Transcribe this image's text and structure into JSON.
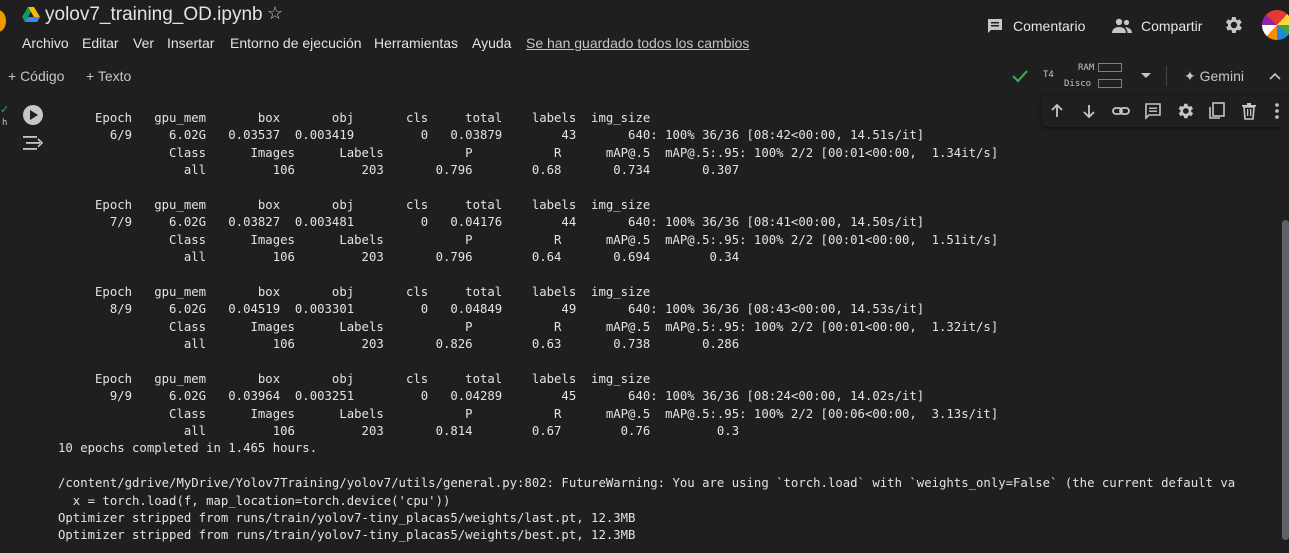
{
  "app": {
    "title": "yolov7_training_OD.ipynb"
  },
  "menu": {
    "items": [
      "Archivo",
      "Editar",
      "Ver",
      "Insertar",
      "Entorno de ejecución",
      "Herramientas",
      "Ayuda"
    ],
    "saved_status": "Se han guardado todos los cambios"
  },
  "header": {
    "comment_label": "Comentario",
    "share_label": "Compartir"
  },
  "toolbar": {
    "code_label": "+ Código",
    "text_label": "+ Texto",
    "runtime_type": "T4",
    "ram_label": "RAM",
    "disk_label": "Disco",
    "gemini_label": "Gemini"
  },
  "cell": {
    "status_check": "✓",
    "status_short": "h"
  },
  "output": {
    "lines": [
      "     Epoch   gpu_mem       box       obj       cls     total    labels  img_size",
      "       6/9     6.02G   0.03537  0.003419         0   0.03879        43       640: 100% 36/36 [08:42<00:00, 14.51s/it]",
      "               Class      Images      Labels           P           R      mAP@.5  mAP@.5:.95: 100% 2/2 [00:01<00:00,  1.34it/s]",
      "                 all         106         203       0.796        0.68       0.734       0.307",
      "",
      "     Epoch   gpu_mem       box       obj       cls     total    labels  img_size",
      "       7/9     6.02G   0.03827  0.003481         0   0.04176        44       640: 100% 36/36 [08:41<00:00, 14.50s/it]",
      "               Class      Images      Labels           P           R      mAP@.5  mAP@.5:.95: 100% 2/2 [00:01<00:00,  1.51it/s]",
      "                 all         106         203       0.796        0.64       0.694        0.34",
      "",
      "     Epoch   gpu_mem       box       obj       cls     total    labels  img_size",
      "       8/9     6.02G   0.04519  0.003301         0   0.04849        49       640: 100% 36/36 [08:43<00:00, 14.53s/it]",
      "               Class      Images      Labels           P           R      mAP@.5  mAP@.5:.95: 100% 2/2 [00:01<00:00,  1.32it/s]",
      "                 all         106         203       0.826        0.63       0.738       0.286",
      "",
      "     Epoch   gpu_mem       box       obj       cls     total    labels  img_size",
      "       9/9     6.02G   0.03964  0.003251         0   0.04289        45       640: 100% 36/36 [08:24<00:00, 14.02s/it]",
      "               Class      Images      Labels           P           R      mAP@.5  mAP@.5:.95: 100% 2/2 [00:06<00:00,  3.13s/it]",
      "                 all         106         203       0.814        0.67        0.76         0.3",
      "10 epochs completed in 1.465 hours.",
      "",
      "/content/gdrive/MyDrive/Yolov7Training/yolov7/utils/general.py:802: FutureWarning: You are using `torch.load` with `weights_only=False` (the current default va",
      "  x = torch.load(f, map_location=torch.device('cpu'))",
      "Optimizer stripped from runs/train/yolov7-tiny_placas5/weights/last.pt, 12.3MB",
      "Optimizer stripped from runs/train/yolov7-tiny_placas5/weights/best.pt, 12.3MB"
    ]
  },
  "colors": {
    "background": "#1f1f1f",
    "text": "#e3e3e3",
    "accent_green": "#34a853",
    "drive_blue": "#4285f4",
    "drive_yellow": "#fbbc04",
    "drive_green": "#0f9d58"
  },
  "icons": {
    "logo": "google-drive-logo",
    "star": "star-outline-icon",
    "comment": "comment-icon",
    "share": "people-icon",
    "settings": "gear-icon",
    "connected": "check-icon",
    "dropdown": "chevron-down-icon",
    "gemini": "sparkle-icon",
    "run": "play-icon",
    "output_options": "output-options-icon",
    "move_up": "arrow-up-icon",
    "move_down": "arrow-down-icon",
    "link": "link-icon",
    "cell_comment": "comment-icon",
    "cell_settings": "gear-icon",
    "mirror": "mirror-cell-icon",
    "delete": "trash-icon",
    "more": "more-vert-icon"
  }
}
